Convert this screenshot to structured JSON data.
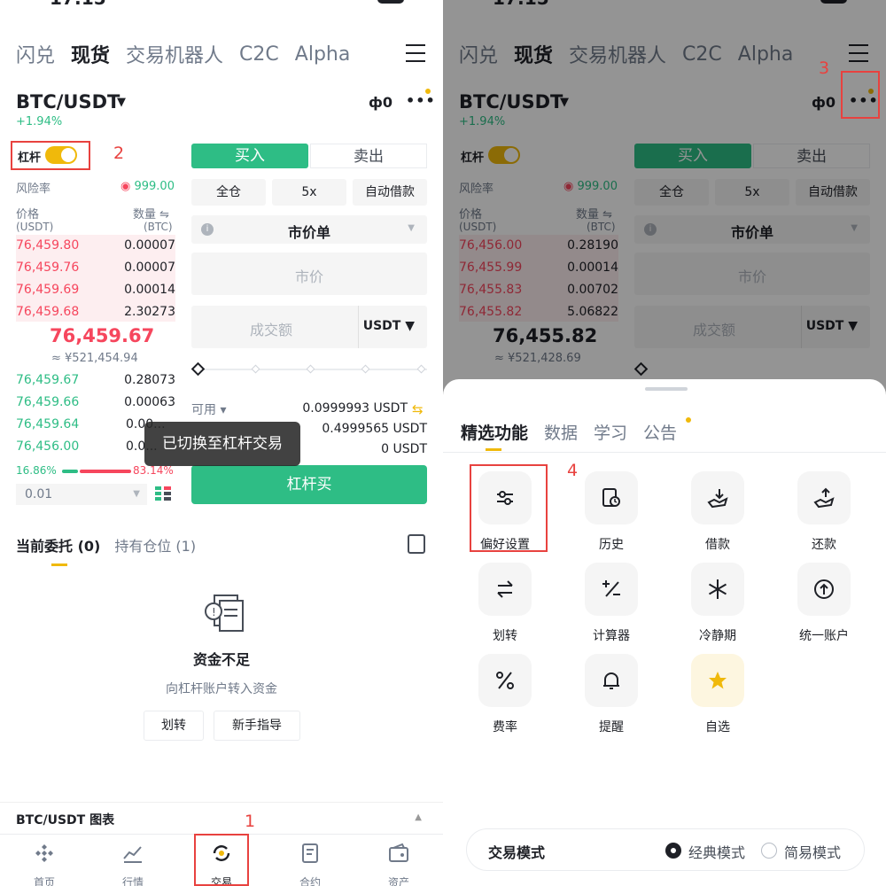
{
  "left": {
    "status": {
      "time": "17:15"
    },
    "top_tabs": [
      "闪兑",
      "现货",
      "交易机器人",
      "C2C",
      "Alpha"
    ],
    "pair": "BTC/USDT",
    "change": "+1.94%",
    "leverage_label": "杠杆",
    "annotation_2": "2",
    "risk_label": "风险率",
    "risk_value": "999.00",
    "price_header": "价格",
    "price_unit": "(USDT)",
    "qty_header": "数量 ⇋",
    "qty_unit": "(BTC)",
    "asks": [
      {
        "price": "76,459.80",
        "qty": "0.00007"
      },
      {
        "price": "76,459.76",
        "qty": "0.00007"
      },
      {
        "price": "76,459.69",
        "qty": "0.00014"
      },
      {
        "price": "76,459.68",
        "qty": "2.30273"
      }
    ],
    "mid_price": "76,459.67",
    "mid_cny": "≈ ¥521,454.94",
    "bids": [
      {
        "price": "76,459.67",
        "qty": "0.28073"
      },
      {
        "price": "76,459.66",
        "qty": "0.00063"
      },
      {
        "price": "76,459.64",
        "qty": "0.00..."
      },
      {
        "price": "76,456.00",
        "qty": "0.0..."
      }
    ],
    "buy_ratio": "16.86%",
    "sell_ratio": "83.14%",
    "depth": "0.01",
    "buy_tab": "买入",
    "sell_tab": "卖出",
    "margin_mode": "全仓",
    "leverage": "5x",
    "auto_borrow": "自动借款",
    "order_type": "市价单",
    "price_placeholder": "市价",
    "amount_placeholder": "成交额",
    "amount_unit": "USDT",
    "avail_label": "可用 ▾",
    "avail_1": "0.0999993 USDT",
    "avail_2": "0.4999565 USDT",
    "avail_3": "0 USDT",
    "main_button": "杠杆买",
    "toast": "已切换至杠杆交易",
    "tab_orders": "当前委托 (0)",
    "tab_positions": "持有仓位 (1)",
    "empty_title": "资金不足",
    "empty_sub": "向杠杆账户转入资金",
    "btn_transfer": "划转",
    "btn_guide": "新手指导",
    "chart_label": "BTC/USDT 图表",
    "annotation_1": "1",
    "nav": [
      "首页",
      "行情",
      "交易",
      "合约",
      "资产"
    ]
  },
  "right": {
    "status": {
      "time": "17:15"
    },
    "top_tabs": [
      "闪兑",
      "现货",
      "交易机器人",
      "C2C",
      "Alpha"
    ],
    "pair": "BTC/USDT",
    "change": "+1.94%",
    "leverage_label": "杠杆",
    "annotation_3": "3",
    "risk_label": "风险率",
    "risk_value": "999.00",
    "price_header": "价格",
    "price_unit": "(USDT)",
    "qty_header": "数量 ⇋",
    "qty_unit": "(BTC)",
    "asks": [
      {
        "price": "76,456.00",
        "qty": "0.28190"
      },
      {
        "price": "76,455.99",
        "qty": "0.00014"
      },
      {
        "price": "76,455.83",
        "qty": "0.00702"
      },
      {
        "price": "76,455.82",
        "qty": "5.06822"
      }
    ],
    "mid_price": "76,455.82",
    "mid_cny": "≈ ¥521,428.69",
    "buy_tab": "买入",
    "sell_tab": "卖出",
    "margin_mode": "全仓",
    "leverage": "5x",
    "auto_borrow": "自动借款",
    "order_type": "市价单",
    "price_placeholder": "市价",
    "amount_placeholder": "成交额",
    "amount_unit": "USDT",
    "sheet_tabs": [
      "精选功能",
      "数据",
      "学习",
      "公告"
    ],
    "annotation_4": "4",
    "functions": [
      {
        "label": "偏好设置",
        "icon": "sliders-icon"
      },
      {
        "label": "历史",
        "icon": "history-icon"
      },
      {
        "label": "借款",
        "icon": "borrow-icon"
      },
      {
        "label": "还款",
        "icon": "repay-icon"
      },
      {
        "label": "划转",
        "icon": "transfer-icon"
      },
      {
        "label": "计算器",
        "icon": "calculator-icon"
      },
      {
        "label": "冷静期",
        "icon": "snowflake-icon"
      },
      {
        "label": "统一账户",
        "icon": "unified-account-icon"
      },
      {
        "label": "费率",
        "icon": "percent-icon"
      },
      {
        "label": "提醒",
        "icon": "bell-icon"
      },
      {
        "label": "自选",
        "icon": "star-icon"
      }
    ],
    "mode_label": "交易模式",
    "mode_classic": "经典模式",
    "mode_simple": "简易模式"
  },
  "colors": {
    "green": "#2ebd85",
    "red": "#f6465d",
    "yellow": "#f0b90b",
    "annotation": "#e8423f"
  }
}
